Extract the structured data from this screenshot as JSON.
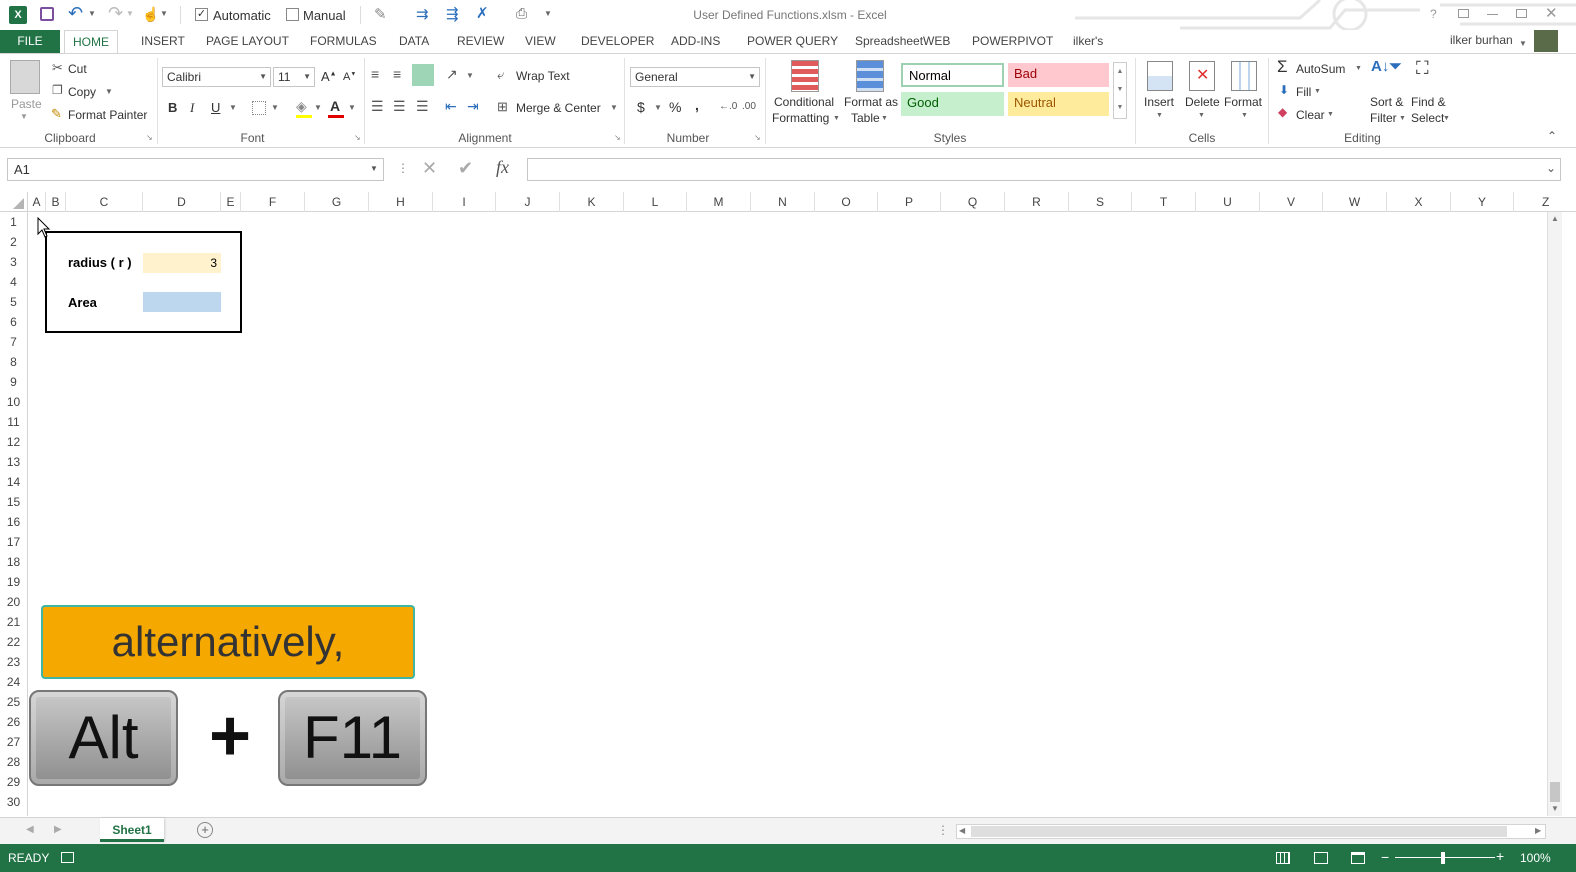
{
  "window": {
    "title": "User Defined Functions.xlsm - Excel",
    "user": "ilker burhan"
  },
  "qat": {
    "automatic_label": "Automatic",
    "manual_label": "Manual",
    "automatic_checked": true,
    "manual_checked": false
  },
  "tabs": [
    "FILE",
    "HOME",
    "INSERT",
    "PAGE LAYOUT",
    "FORMULAS",
    "DATA",
    "REVIEW",
    "VIEW",
    "DEVELOPER",
    "ADD-INS",
    "POWER QUERY",
    "SpreadsheetWEB",
    "POWERPIVOT",
    "ilker's"
  ],
  "ribbon": {
    "clipboard": {
      "paste": "Paste",
      "cut": "Cut",
      "copy": "Copy",
      "format_painter": "Format Painter",
      "label": "Clipboard"
    },
    "font": {
      "name": "Calibri",
      "size": "11",
      "bold": "B",
      "italic": "I",
      "underline": "U",
      "label": "Font"
    },
    "alignment": {
      "wrap": "Wrap Text",
      "merge": "Merge & Center",
      "label": "Alignment"
    },
    "number": {
      "format": "General",
      "currency": "$",
      "percent": "%",
      "comma": ",",
      "label": "Number"
    },
    "styles": {
      "conditional_1": "Conditional",
      "conditional_2": "Formatting",
      "table_1": "Format as",
      "table_2": "Table",
      "normal": "Normal",
      "bad": "Bad",
      "good": "Good",
      "neutral": "Neutral",
      "label": "Styles"
    },
    "cells": {
      "insert": "Insert",
      "delete": "Delete",
      "format": "Format",
      "label": "Cells"
    },
    "editing": {
      "autosum": "AutoSum",
      "fill": "Fill",
      "clear": "Clear",
      "sort_1": "Sort &",
      "sort_2": "Filter",
      "find_1": "Find &",
      "find_2": "Select",
      "label": "Editing"
    }
  },
  "formula_bar": {
    "name_box": "A1",
    "fx": "fx",
    "formula": ""
  },
  "columns": [
    "A",
    "B",
    "C",
    "D",
    "E",
    "F",
    "G",
    "H",
    "I",
    "J",
    "K",
    "L",
    "M",
    "N",
    "O",
    "P",
    "Q",
    "R",
    "S",
    "T",
    "U",
    "V",
    "W",
    "X",
    "Y",
    "Z"
  ],
  "rows": [
    "1",
    "2",
    "3",
    "4",
    "5",
    "6",
    "7",
    "8",
    "9",
    "10",
    "11",
    "12",
    "13",
    "14",
    "15",
    "16",
    "17",
    "18",
    "19",
    "20",
    "21",
    "22",
    "23",
    "24",
    "25",
    "26",
    "27",
    "28",
    "29",
    "30"
  ],
  "cells": {
    "radius_label": "radius ( r )",
    "radius_value": "3",
    "area_label": "Area",
    "area_value": ""
  },
  "overlay": {
    "caption": "alternatively,",
    "key1": "Alt",
    "plus": "+",
    "key2": "F11"
  },
  "sheet": {
    "name": "Sheet1"
  },
  "status": {
    "ready": "READY",
    "zoom": "100%"
  },
  "colors": {
    "excel_green": "#217346",
    "radius_fill": "#fff2cc",
    "area_fill": "#bdd7ee",
    "caption_bg": "#f5a800",
    "caption_border": "#3fb5a3"
  }
}
